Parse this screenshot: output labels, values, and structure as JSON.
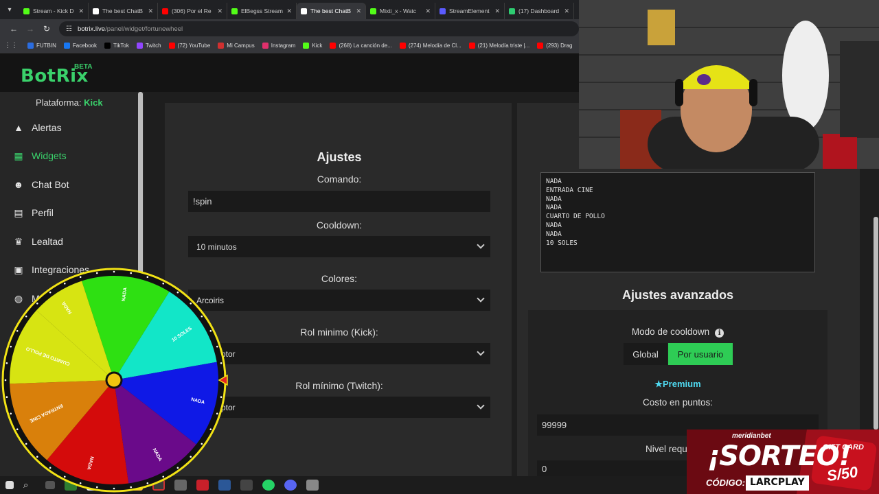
{
  "browser": {
    "tabs": [
      {
        "label": "Stream - Kick D",
        "color": "#53fc18"
      },
      {
        "label": "The best ChatB",
        "color": "#ffffff",
        "active": false
      },
      {
        "label": "(306) Por el Re",
        "color": "#ff0000"
      },
      {
        "label": "ElBegss Stream",
        "color": "#53fc18"
      },
      {
        "label": "The best ChatB",
        "color": "#ffffff",
        "active": true
      },
      {
        "label": "Mixti_x - Watc",
        "color": "#53fc18"
      },
      {
        "label": "StreamElement",
        "color": "#5b5bff"
      },
      {
        "label": "(17) Dashboard",
        "color": "#2ecc71"
      }
    ],
    "url_host": "botrix.live",
    "url_path": "/panel/widget/fortunewheel",
    "bookmarks": [
      {
        "label": "FUTBIN",
        "color": "#2b6de0"
      },
      {
        "label": "Facebook",
        "color": "#1877f2"
      },
      {
        "label": "TikTok",
        "color": "#000000"
      },
      {
        "label": "Twitch",
        "color": "#9146ff"
      },
      {
        "label": "(72) YouTube",
        "color": "#ff0000"
      },
      {
        "label": "Mi Campus",
        "color": "#d03030"
      },
      {
        "label": "Instagram",
        "color": "#e1306c"
      },
      {
        "label": "Kick",
        "color": "#53fc18"
      },
      {
        "label": "(268) La canción de...",
        "color": "#ff0000"
      },
      {
        "label": "(274) Melodía de Cl...",
        "color": "#ff0000"
      },
      {
        "label": "(21) Melodía triste |...",
        "color": "#ff0000"
      },
      {
        "label": "(293) Drag",
        "color": "#ff0000"
      }
    ]
  },
  "app": {
    "logo": "BotRix",
    "beta": "BETA"
  },
  "sidebar": {
    "platform_label": "Plataforma:",
    "platform_value": "Kick",
    "items": [
      {
        "label": "Alertas",
        "icon": "warning-icon"
      },
      {
        "label": "Widgets",
        "icon": "grid-icon",
        "active": true
      },
      {
        "label": "Chat Bot",
        "icon": "robot-icon"
      },
      {
        "label": "Perfil",
        "icon": "id-card-icon"
      },
      {
        "label": "Lealtad",
        "icon": "trophy-icon"
      },
      {
        "label": "Integraciones",
        "icon": "puzzle-icon"
      },
      {
        "label": "M",
        "icon": "gamepad-icon"
      }
    ]
  },
  "settings": {
    "title": "Ajustes",
    "command_label": "Comando:",
    "command_value": "!spin",
    "cooldown_label": "Cooldown:",
    "cooldown_value": "10 minutos",
    "colors_label": "Colores:",
    "colors_value": "Arcoiris",
    "role_kick_label": "Rol minimo (Kick):",
    "role_kick_value": "ptor",
    "role_twitch_label": "Rol mínimo (Twitch):",
    "role_twitch_value": "ptor"
  },
  "prizes_text": "NADA\nENTRADA CINE\nNADA\nNADA\nCUARTO DE POLLO\nNADA\nNADA\n10 SOLES",
  "advanced": {
    "title": "Ajustes avanzados",
    "cooldown_mode_label": "Modo de cooldown",
    "mode_global": "Global",
    "mode_user": "Por usuario",
    "premium": "Premium",
    "cost_label": "Costo en puntos:",
    "cost_value": "99999",
    "level_label": "Nivel requ",
    "level_value": "0"
  },
  "wheel": {
    "segments": [
      {
        "label": "NADA",
        "color": "#2ee012"
      },
      {
        "label": "10 SOLES",
        "color": "#12e6c8"
      },
      {
        "label": "NADA",
        "color": "#0f19e6"
      },
      {
        "label": "NADA",
        "color": "#6a0a8a"
      },
      {
        "label": "NADA",
        "color": "#d40b0b"
      },
      {
        "label": "ENTRADA CINE",
        "color": "#d9800b"
      },
      {
        "label": "CUARTO DE POLLO",
        "color": "#d7e412"
      },
      {
        "label": "NADA",
        "color": "#d7e412"
      }
    ]
  },
  "promo": {
    "brand": "meridianbet",
    "headline": "¡SORTEO!",
    "code_label": "CÓDIGO:",
    "code_value": "LARCPLAY",
    "gift": "GIFT CARD",
    "amount": "S/50"
  }
}
